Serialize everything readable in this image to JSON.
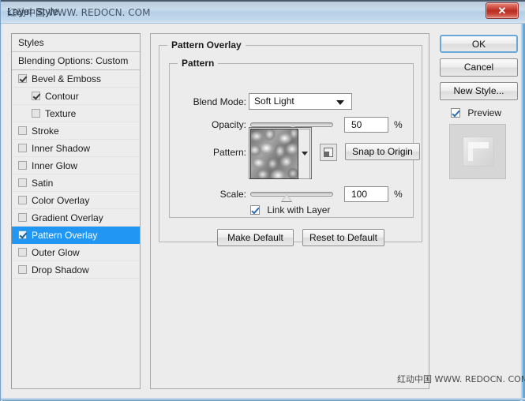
{
  "window": {
    "title": "Layer Style",
    "title_watermark": "红动中国 WWW. REDOCN. COM",
    "close_label": "✕",
    "bottom_watermark": "红动中国 WWW. REDOCN. COM"
  },
  "styles_panel": {
    "header": "Styles",
    "blending_options": "Blending Options: Custom",
    "items": [
      {
        "label": "Bevel & Emboss",
        "checked": true,
        "indent": false,
        "selected": false
      },
      {
        "label": "Contour",
        "checked": true,
        "indent": true,
        "selected": false
      },
      {
        "label": "Texture",
        "checked": false,
        "indent": true,
        "selected": false
      },
      {
        "label": "Stroke",
        "checked": false,
        "indent": false,
        "selected": false
      },
      {
        "label": "Inner Shadow",
        "checked": false,
        "indent": false,
        "selected": false
      },
      {
        "label": "Inner Glow",
        "checked": false,
        "indent": false,
        "selected": false
      },
      {
        "label": "Satin",
        "checked": false,
        "indent": false,
        "selected": false
      },
      {
        "label": "Color Overlay",
        "checked": false,
        "indent": false,
        "selected": false
      },
      {
        "label": "Gradient Overlay",
        "checked": false,
        "indent": false,
        "selected": false
      },
      {
        "label": "Pattern Overlay",
        "checked": true,
        "indent": false,
        "selected": true
      },
      {
        "label": "Outer Glow",
        "checked": false,
        "indent": false,
        "selected": false
      },
      {
        "label": "Drop Shadow",
        "checked": false,
        "indent": false,
        "selected": false
      }
    ]
  },
  "main": {
    "group_title": "Pattern Overlay",
    "subgroup_title": "Pattern",
    "blend_mode": {
      "label": "Blend Mode:",
      "value": "Soft Light"
    },
    "opacity": {
      "label": "Opacity:",
      "value": "50",
      "unit": "%",
      "percent": 50
    },
    "pattern": {
      "label": "Pattern:",
      "snap_to_origin_label": "Snap to Origin",
      "new_pattern_icon": "new-pattern-icon"
    },
    "scale": {
      "label": "Scale:",
      "value": "100",
      "unit": "%",
      "percent": 43
    },
    "link_with_layer": {
      "label": "Link with Layer",
      "checked": true
    },
    "make_default_label": "Make Default",
    "reset_default_label": "Reset to Default"
  },
  "buttons": {
    "ok": "OK",
    "cancel": "Cancel",
    "new_style": "New Style...",
    "preview_label": "Preview",
    "preview_checked": true
  },
  "colors": {
    "selection_blue": "#2196f3",
    "titlebar_blue": "#c9dcec",
    "close_red": "#b92d21",
    "default_button_outline": "#6aa8d8"
  }
}
